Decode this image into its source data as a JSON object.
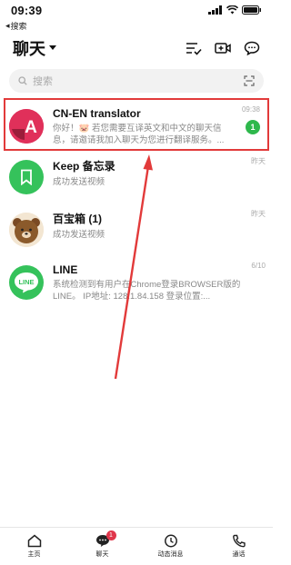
{
  "status": {
    "time": "09:39"
  },
  "back": {
    "label": "搜索"
  },
  "header": {
    "title": "聊天"
  },
  "search": {
    "placeholder": "搜索"
  },
  "chats": [
    {
      "name": "CN-EN translator",
      "message": "你好！🐷 若您需要互译英文和中文的聊天信息，请邀请我加入聊天为您进行翻译服务。...",
      "time": "09:38",
      "unread": "1",
      "avatar_text": "A",
      "avatar_color": "#e0305a"
    },
    {
      "name": "Keep 备忘录",
      "message": "成功发送视频",
      "time": "昨天",
      "avatar_color": "#35c25b"
    },
    {
      "name": "百宝箱 (1)",
      "message": "成功发送视频",
      "time": "昨天",
      "avatar_color": "#8b5a2b"
    },
    {
      "name": "LINE",
      "message": "系统检测到有用户在Chrome登录BROWSER版的LINE。 IP地址: 128.1.84.158 登录位置:...",
      "time": "6/10",
      "avatar_text": "LINE",
      "avatar_color": "#35c25b"
    }
  ],
  "tabs": [
    {
      "label": "主页"
    },
    {
      "label": "聊天",
      "badge": "1"
    },
    {
      "label": "动态消息"
    },
    {
      "label": "通话"
    }
  ],
  "colors": {
    "highlight": "#e23a3a",
    "line_green": "#35c25b",
    "badge_red": "#e0364b"
  }
}
